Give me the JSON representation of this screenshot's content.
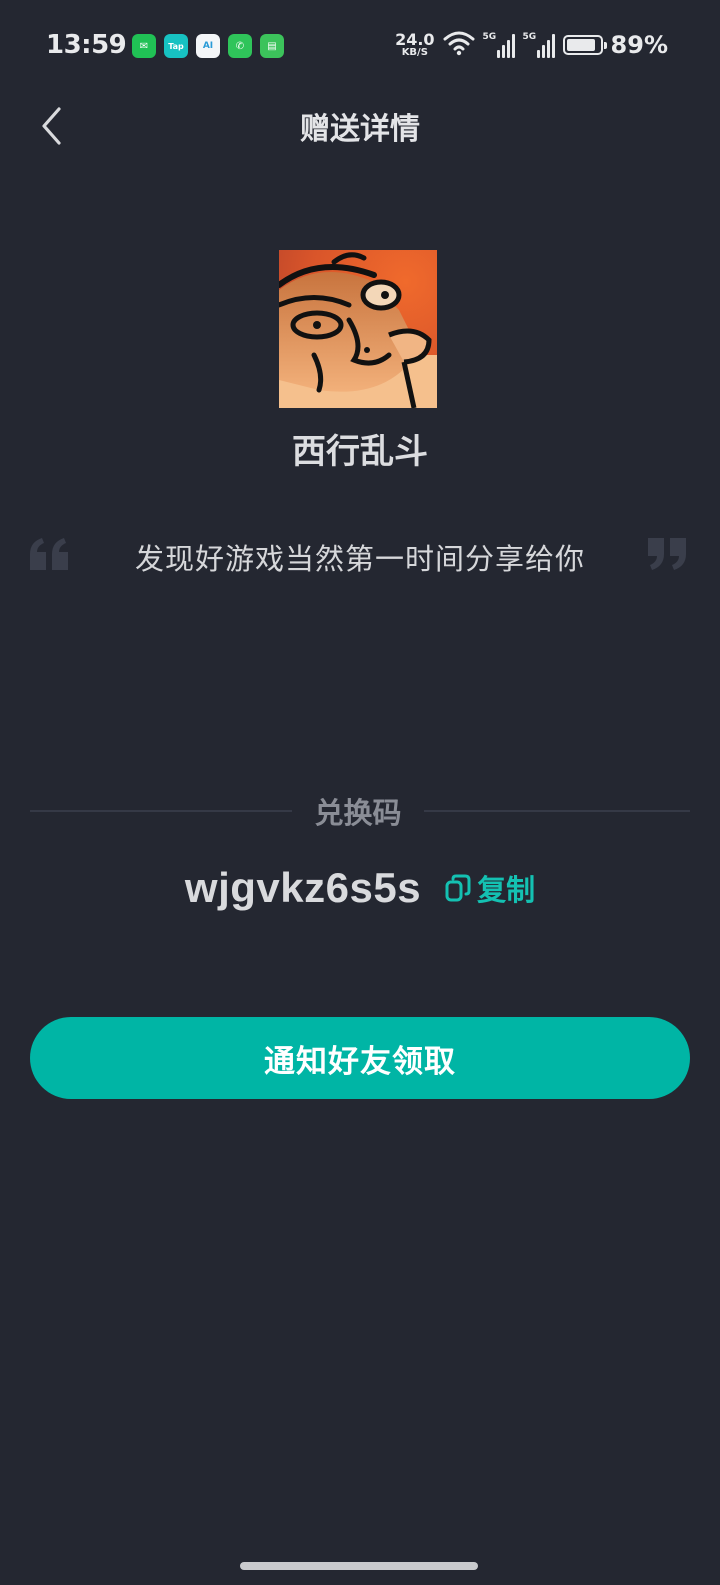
{
  "status_bar": {
    "time": "13:59",
    "notifications": [
      {
        "icon": "wechat-icon",
        "glyph": "✉"
      },
      {
        "icon": "taptap-icon",
        "glyph": "Tap"
      },
      {
        "icon": "smart-home-icon",
        "glyph": "AI"
      },
      {
        "icon": "phone-icon",
        "glyph": "✆"
      },
      {
        "icon": "message-icon",
        "glyph": "▤"
      }
    ],
    "net_speed_value": "24.0",
    "net_speed_unit": "KB/S",
    "signal_1_label": "5G",
    "signal_2_label": "5G",
    "battery_level": 0.89,
    "battery_text": "89%"
  },
  "header": {
    "title": "赠送详情",
    "back_icon": "chevron-left-icon"
  },
  "game": {
    "name": "西行乱斗"
  },
  "quote": {
    "text": "发现好游戏当然第一时间分享给你"
  },
  "redeem": {
    "label": "兑换码",
    "code": "wjgvkz6s5s",
    "copy_label": "复制",
    "copy_icon": "copy-icon"
  },
  "actions": {
    "notify_label": "通知好友领取"
  },
  "colors": {
    "background": "#242731",
    "accent": "#00b5a5",
    "copy_accent": "#14c1b2"
  }
}
